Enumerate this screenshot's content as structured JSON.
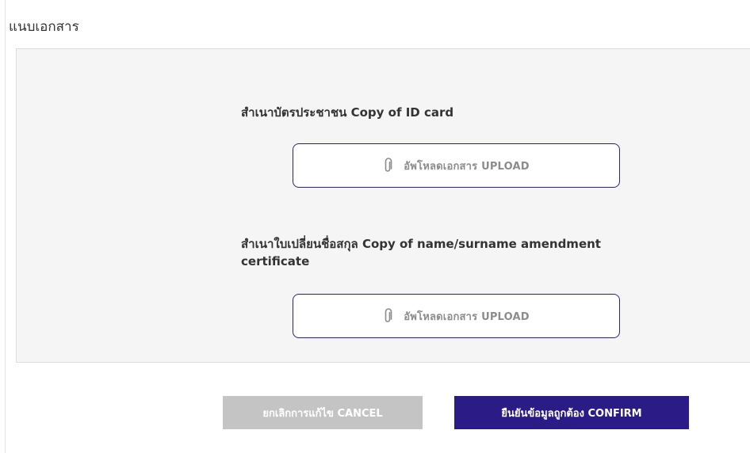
{
  "section": {
    "title": "แนบเอกสาร"
  },
  "documents": [
    {
      "label": "สำเนาบัตรประชาชน Copy of ID card",
      "upload_label": "อัพโหลดเอกสาร UPLOAD",
      "icon": "paperclip-icon"
    },
    {
      "label": "สำเนาใบเปลี่ยนชื่อสกุล Copy of name/surname amendment certificate",
      "upload_label": "อัพโหลดเอกสาร UPLOAD",
      "icon": "paperclip-icon"
    }
  ],
  "actions": {
    "cancel_label": "ยกเลิกการแก้ไข CANCEL",
    "confirm_label": "ยืนยันข้อมูลถูกต้อง CONFIRM"
  },
  "colors": {
    "accent": "#2b1b86",
    "upload_border": "#2b2089",
    "cancel_bg": "#c4c4c4",
    "panel_bg": "#f5f5f6"
  }
}
